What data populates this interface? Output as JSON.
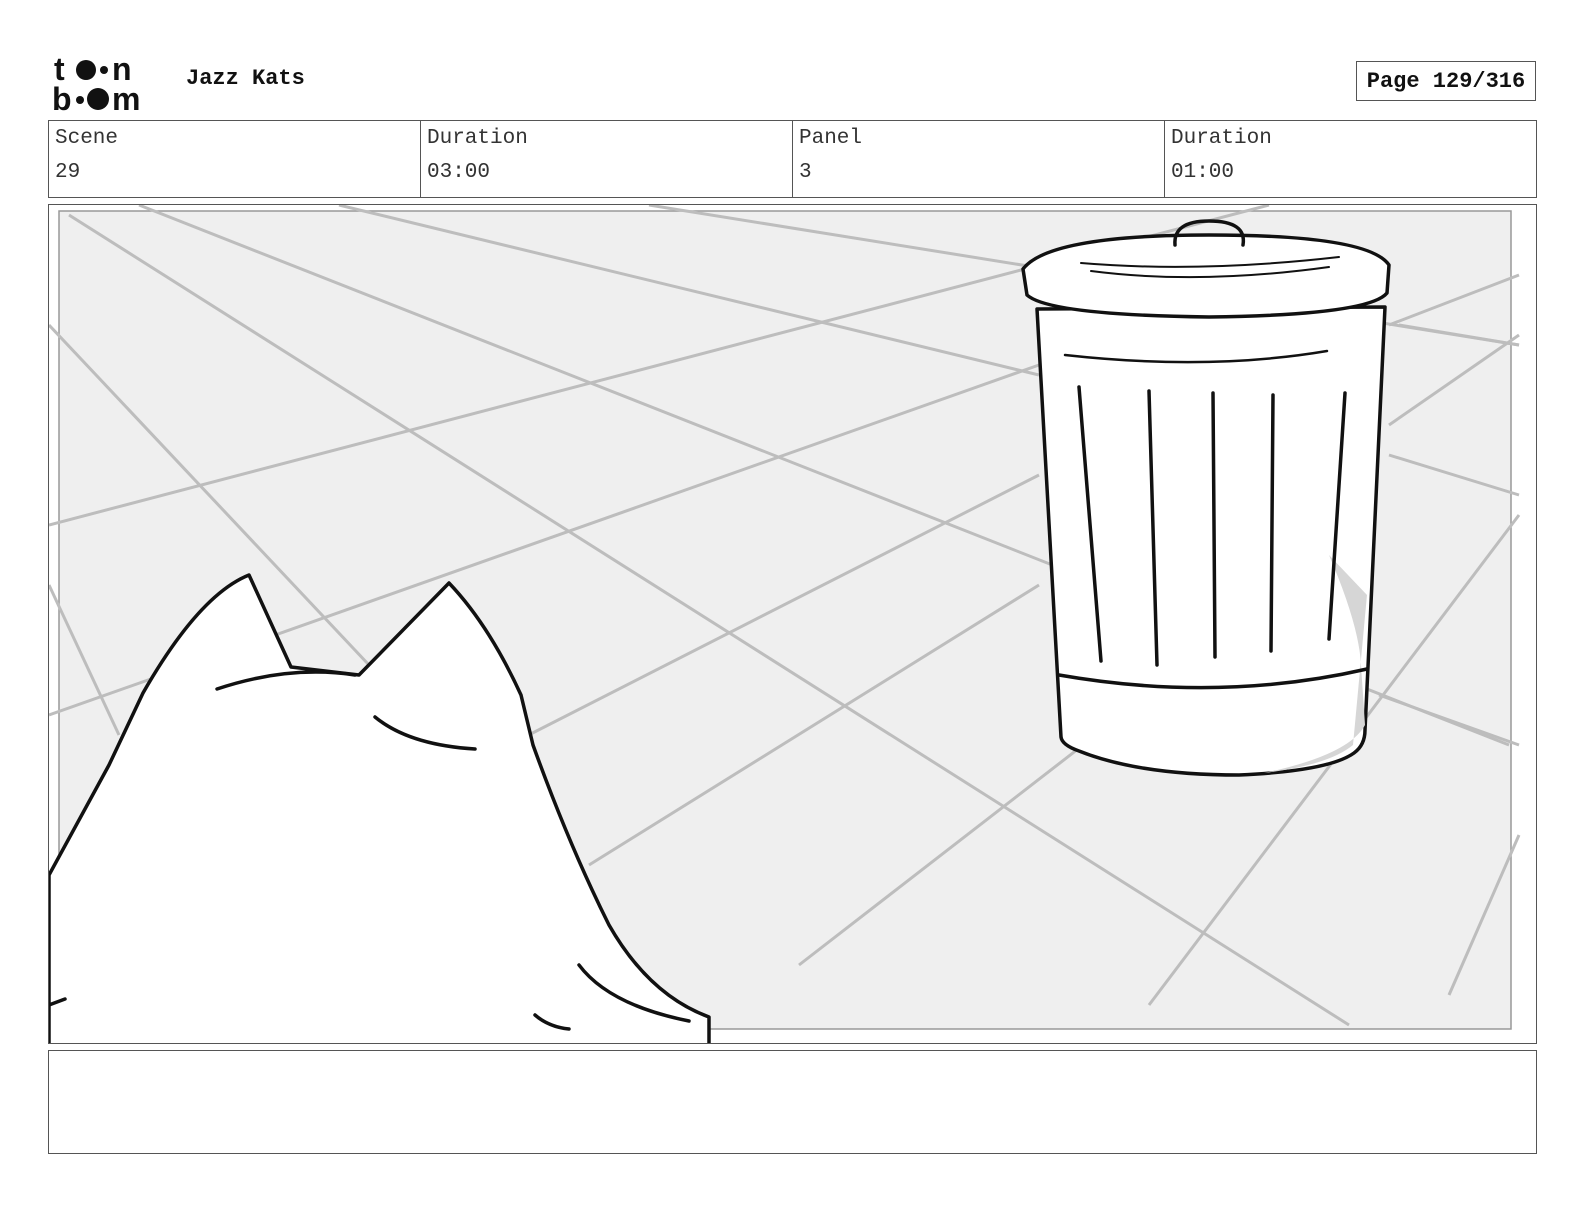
{
  "header": {
    "logo_text": "toonboom",
    "project_title": "Jazz Kats",
    "page_label": "Page 129/316"
  },
  "info": {
    "scene_label": "Scene",
    "scene_value": "29",
    "scene_duration_label": "Duration",
    "scene_duration_value": "03:00",
    "panel_label": "Panel",
    "panel_value": "3",
    "panel_duration_label": "Duration",
    "panel_duration_value": "01:00"
  },
  "panel": {
    "subjects": [
      "cat-head-silhouette",
      "trash-can",
      "tiled-floor"
    ]
  },
  "notes": {
    "text": ""
  }
}
